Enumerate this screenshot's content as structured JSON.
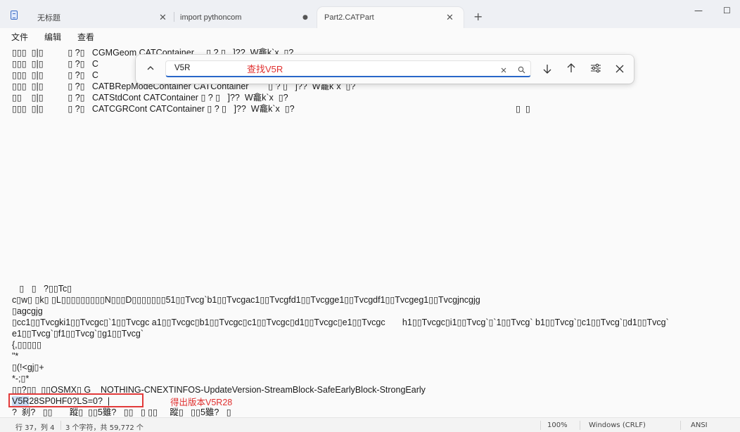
{
  "tabs": [
    {
      "label": "无标题",
      "button": "✕"
    },
    {
      "label": "import pythoncom",
      "button": "●"
    },
    {
      "label": "Part2.CATPart",
      "button": "✕"
    }
  ],
  "new_tab": "+",
  "window_controls": {
    "minimize": "—",
    "maximize": "☐"
  },
  "menu": [
    "文件",
    "编辑",
    "查看"
  ],
  "find": {
    "query": "V5R",
    "annotation": "查找V5R",
    "icons": [
      "chevron-up-icon",
      "clear-icon",
      "search-icon",
      "arrow-down-icon",
      "arrow-up-icon",
      "options-icon",
      "close-icon"
    ]
  },
  "editor_lines": {
    "l1": "▯▯▯  ▯|▯          ▯ ?▯   CGMGeom CATContainer     ▯ ? ▯   ]??  W龕k`x  ▯?",
    "l2": "▯▯▯  ▯|▯          ▯ ?▯   C",
    "l3": "▯▯▯  ▯|▯          ▯ ?▯   C",
    "l4a": "▯▯▯  ▯|▯          ▯ ?▯   CATBRepModeContainer CATContainer        ▯ ? ▯   ]??  W龕k`x  ▯?",
    "l5": "▯▯    ▯|▯          ▯ ?▯   CATStdCont CATContainer ▯ ? ▯   ]??  W龕k`x  ▯?",
    "l6": "▯▯▯  ▯|▯          ▯ ?▯   CATCGRCont CATContainer ▯ ? ▯   ]??  W龕k`x  ▯?",
    "l6b": "▯  ▯",
    "l7": "   ▯   ▯   ?▯▯Tc▯",
    "l8": "c▯w▯ ▯k▯ ▯L▯▯▯▯▯▯▯▯▯N▯▯▯D▯▯▯▯▯▯▯51▯▯Tvcg`b1▯▯Tvcgac1▯▯Tvcgfd1▯▯Tvcgge1▯▯Tvcgdf1▯▯Tvcgeg1▯▯Tvcgjncgjg",
    "l9": "▯agcgjg",
    "l10": "▯cc1▯▯Tvcgki1▯▯Tvcgc▯`1▯▯Tvcgc a1▯▯Tvcgc▯b1▯▯Tvcgc▯c1▯▯Tvcgc▯d1▯▯Tvcgc▯e1▯▯Tvcgc       h1▯▯Tvcgc▯i1▯▯Tvcg`▯`1▯▯Tvcg` b1▯▯Tvcg`▯c1▯▯Tvcg`▯d1▯▯Tvcg`",
    "l11": "e1▯▯Tvcg`▯f1▯▯Tvcg`▯g1▯▯Tvcg`",
    "l12": "{,▯▯▯▯▯",
    "l13": "\"*",
    "l14": "▯(!<gj▯+",
    "l15": "*-;▯*",
    "l16": "▯▯?▯▯  ▯▯OSMX▯ G    NOTHING-CNEXTINFOS-UpdateVersion-StreamBlock-SafeEarlyBlock-StrongEarly",
    "l17_match": "V5R",
    "l17_rest": "28SP0HF0?LS=0?  |",
    "l18": "?  刹?   ▯▯       蹤▯  ▯▯5雖?   ▯▯   ▯ ▯▯     蹤▯   ▯▯5雖?   ▯"
  },
  "result_annotation": "得出版本V5R28",
  "status": {
    "position": "行 37，列 4",
    "chars": "3 个字符，共 59,772 个",
    "zoom": "100%",
    "line_ending": "Windows (CRLF)",
    "encoding": "ANSI"
  },
  "colors": {
    "annotation_red": "#e0302f",
    "find_underline": "#2967c9",
    "match_highlight": "#cbdcf3"
  }
}
